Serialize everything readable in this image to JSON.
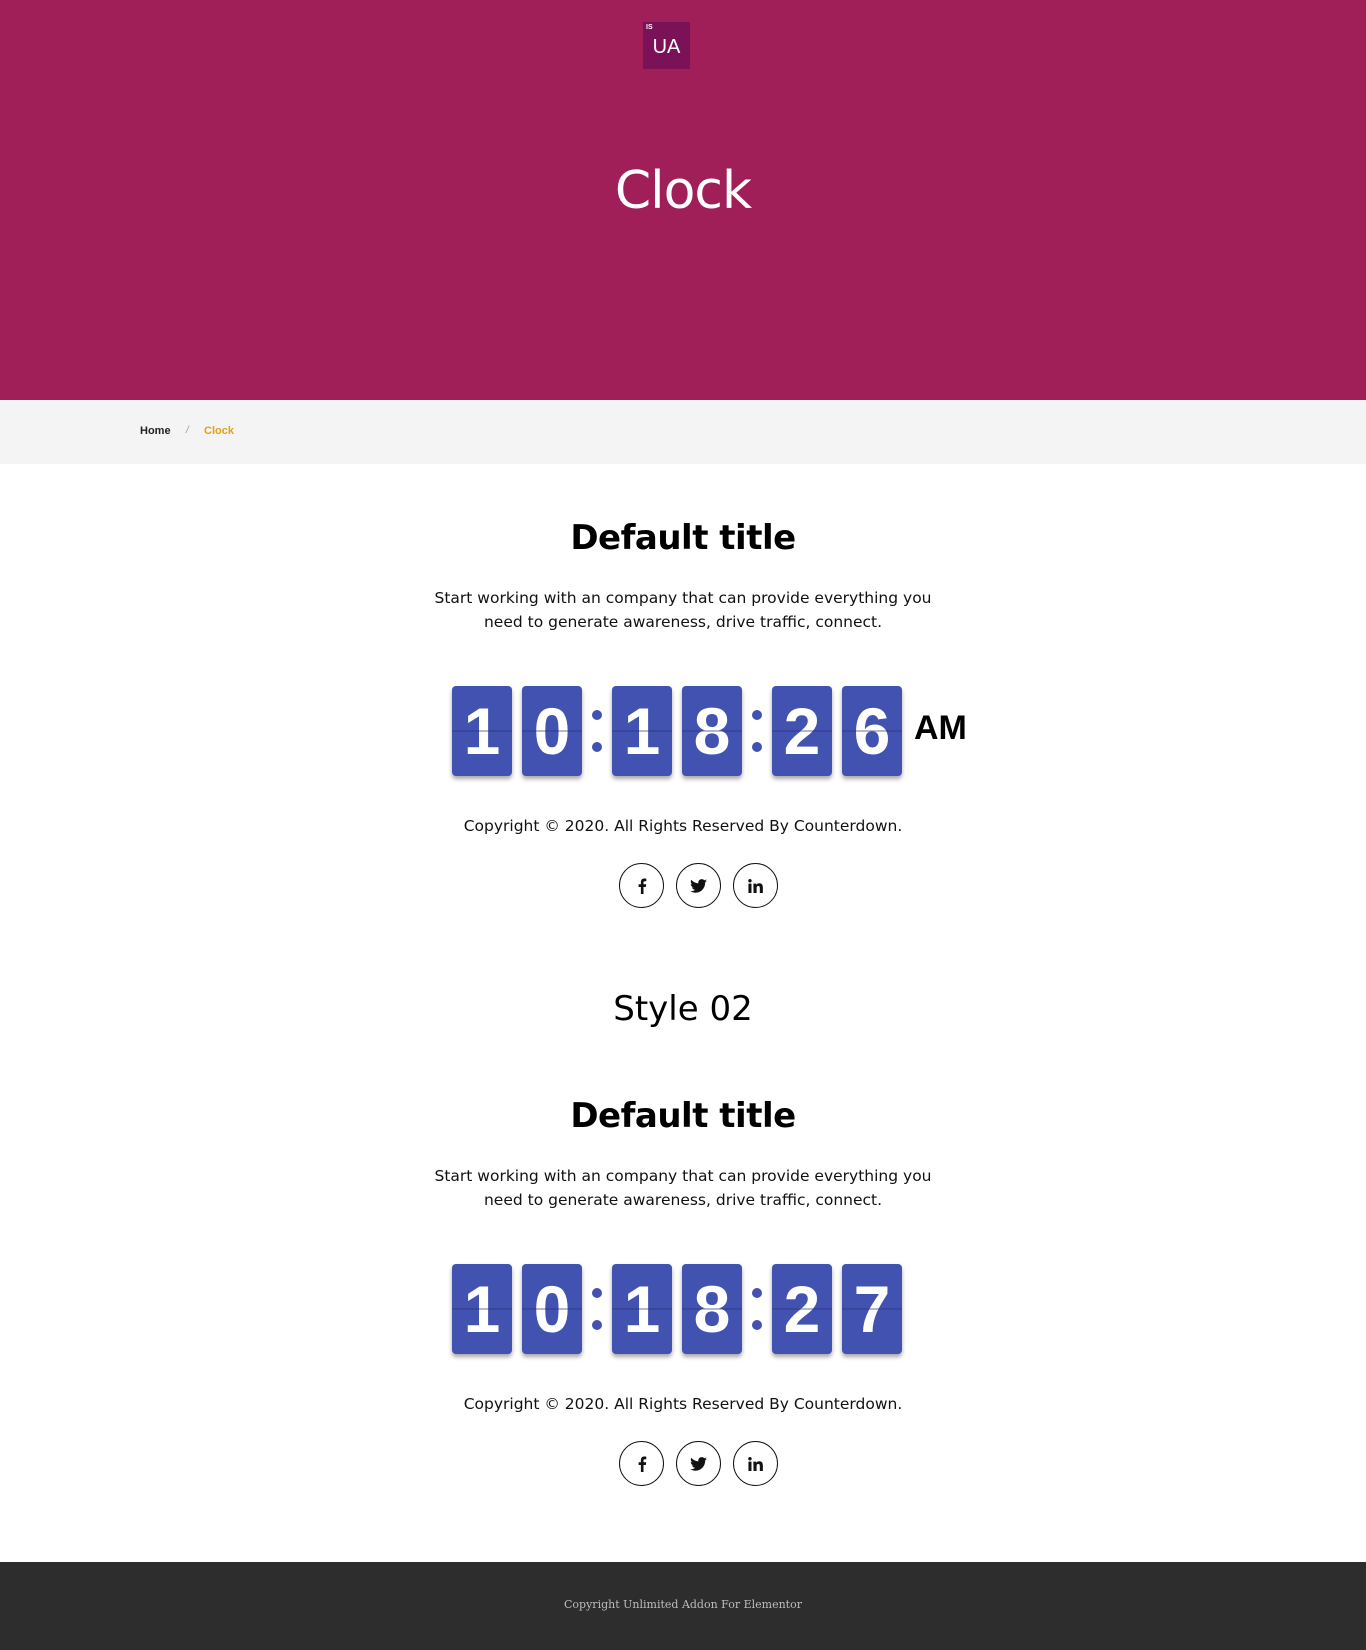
{
  "header": {
    "logo_badge": "IS",
    "logo_text": "UA",
    "title": "Clock"
  },
  "breadcrumb": {
    "home": "Home",
    "separator": "/",
    "current": "Clock"
  },
  "style_heading": "Style 02",
  "sections": [
    {
      "title": "Default title",
      "description": "Start working with an company that can provide everything you need to generate awareness, drive traffic, connect.",
      "clock": {
        "digits": [
          "1",
          "0",
          "1",
          "8",
          "2",
          "6"
        ],
        "period": "AM"
      },
      "copyright": "Copyright © 2020. All Rights Reserved By Counterdown.",
      "social": [
        "facebook-icon",
        "twitter-icon",
        "linkedin-icon"
      ]
    },
    {
      "title": "Default title",
      "description": "Start working with an company that can provide everything you need to generate awareness, drive traffic, connect.",
      "clock": {
        "digits": [
          "1",
          "0",
          "1",
          "8",
          "2",
          "7"
        ]
      },
      "copyright": "Copyright © 2020. All Rights Reserved By Counterdown.",
      "social": [
        "facebook-icon",
        "twitter-icon",
        "linkedin-icon"
      ]
    }
  ],
  "footer": {
    "text": "Copyright Unlimited Addon For Elementor"
  },
  "colors": {
    "hero_bg": "#a01f58",
    "digit_bg": "#4252b0",
    "breadcrumb_active": "#e6a012",
    "footer_bg": "#2d2d2d"
  }
}
